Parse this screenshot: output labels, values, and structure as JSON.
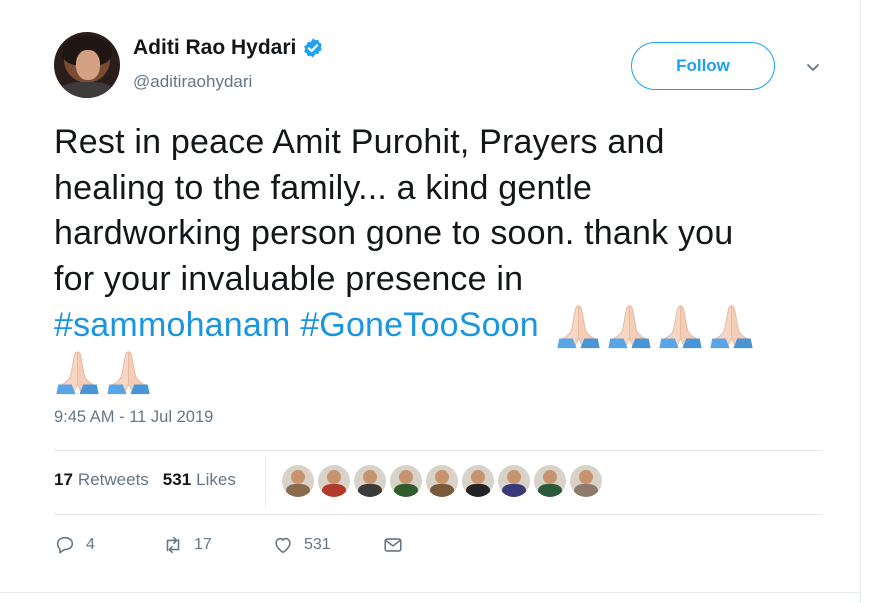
{
  "user": {
    "display_name": "Aditi Rao Hydari",
    "handle": "@aditiraohydari",
    "verified": true
  },
  "follow_button": {
    "label": "Follow"
  },
  "tweet": {
    "lines": [
      "Rest in peace Amit Purohit, Prayers and",
      "healing to the family... a kind gentle",
      "hardworking person gone to soon. thank you",
      "for your invaluable  presence in"
    ],
    "hashtags": [
      "#sammohanam",
      "#GoneTooSoon"
    ],
    "emoji": "folded-hands",
    "emoji_count": 6
  },
  "timestamp": "9:45 AM - 11 Jul 2019",
  "stats": {
    "retweets_count": "17",
    "retweets_label": "Retweets",
    "likes_count": "531",
    "likes_label": "Likes"
  },
  "likers": [
    {
      "name": "liker-avatar-1",
      "color": "#8a6b4e"
    },
    {
      "name": "liker-avatar-2",
      "color": "#b23a2a"
    },
    {
      "name": "liker-avatar-3",
      "color": "#3b3b3b"
    },
    {
      "name": "liker-avatar-4",
      "color": "#2f5b2f"
    },
    {
      "name": "liker-avatar-5",
      "color": "#7a5a3a"
    },
    {
      "name": "liker-avatar-6",
      "color": "#222222"
    },
    {
      "name": "liker-avatar-7",
      "color": "#3a3a7a"
    },
    {
      "name": "liker-avatar-8",
      "color": "#2a5a3a"
    },
    {
      "name": "liker-avatar-9",
      "color": "#8d7a6a"
    }
  ],
  "actions": {
    "reply_count": "4",
    "retweet_count": "17",
    "like_count": "531"
  },
  "colors": {
    "accent": "#1da1f2",
    "hashtag": "#1b95e0",
    "text": "#14171a",
    "secondary": "#657786",
    "divider": "#e6ecf0"
  }
}
